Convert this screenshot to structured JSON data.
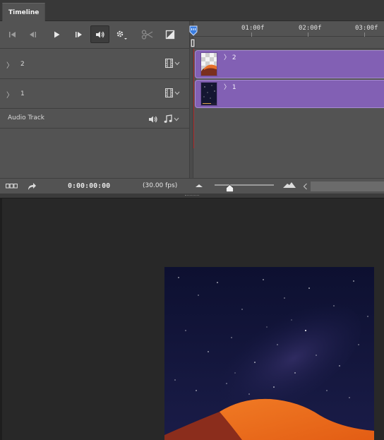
{
  "panel": {
    "tab_title": "Timeline"
  },
  "controls": {
    "icons": [
      "go-to-first-frame-icon",
      "previous-frame-icon",
      "play-icon",
      "next-frame-icon",
      "audio-icon",
      "settings-gear-icon",
      "split-scissors-icon",
      "transition-icon"
    ]
  },
  "ruler": {
    "labels": [
      "01:00f",
      "02:00f",
      "03:00f"
    ]
  },
  "tracks": [
    {
      "name": "2",
      "clip_label": "2"
    },
    {
      "name": "1",
      "clip_label": "1"
    }
  ],
  "audio_track": {
    "name": "Audio Track"
  },
  "bottom": {
    "timecode": "0:00:00:00",
    "fps": "(30.00 fps)",
    "zoom_level": 0.25
  },
  "colors": {
    "clip": "#8260b4",
    "playhead": "#3a7de0",
    "panel": "#535353",
    "workspace": "#282828"
  }
}
